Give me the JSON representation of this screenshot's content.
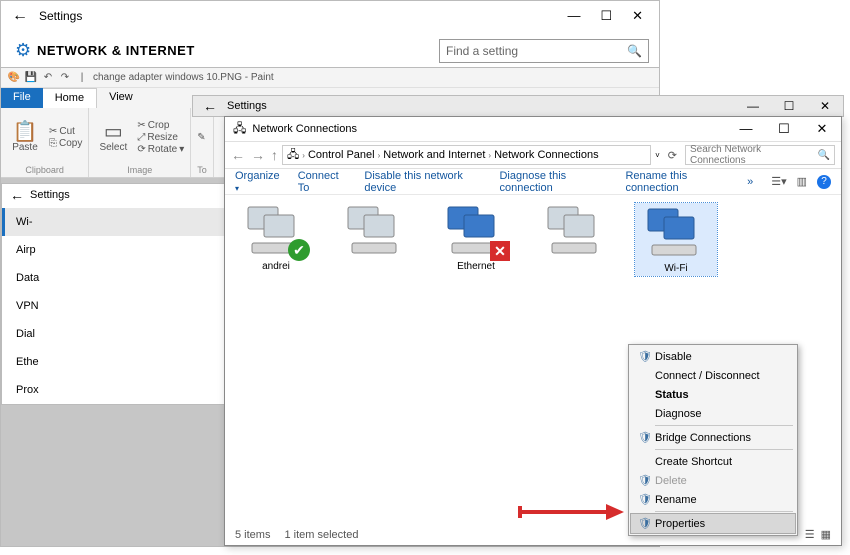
{
  "settings": {
    "title": "Settings",
    "heading": "NETWORK & INTERNET",
    "search_placeholder": "Find a setting",
    "window_buttons": {
      "min": "—",
      "max": "☐",
      "close": "✕"
    },
    "sidebar": [
      {
        "label": "Wi-Fi",
        "selected": true
      },
      {
        "label": "Airplane mode"
      },
      {
        "label": "Data usage"
      },
      {
        "label": "VPN"
      },
      {
        "label": "Dial-up"
      },
      {
        "label": "Ethernet"
      },
      {
        "label": "Proxy"
      }
    ]
  },
  "paint": {
    "filename": "change adapter windows 10.PNG - Paint",
    "tabs": {
      "file": "File",
      "home": "Home",
      "view": "View"
    },
    "ribbon": {
      "clipboard": {
        "name": "Clipboard",
        "paste": "Paste",
        "cut": "Cut",
        "copy": "Copy"
      },
      "image": {
        "name": "Image",
        "select": "Select",
        "crop": "Crop",
        "resize": "Resize",
        "rotate": "Rotate"
      },
      "tools": {
        "name": "To"
      }
    },
    "inner_settings": {
      "title": "Settings",
      "items": [
        "Wi-",
        "Airp",
        "Data",
        "VPN",
        "Dial",
        "Ethe",
        "Prox"
      ],
      "selected_index": 0
    }
  },
  "settings2_top": {
    "title": "Settings",
    "window_buttons": {
      "min": "—",
      "max": "☐",
      "close": "✕"
    }
  },
  "nc": {
    "title": "Network Connections",
    "breadcrumb": [
      "Control Panel",
      "Network and Internet",
      "Network Connections"
    ],
    "search_placeholder": "Search Network Connections",
    "toolbar": {
      "organize": "Organize",
      "connect": "Connect To",
      "disable": "Disable this network device",
      "diagnose": "Diagnose this connection",
      "rename": "Rename this connection",
      "more": "»"
    },
    "items": [
      {
        "label": "andrei",
        "overlay": "ok"
      },
      {
        "label": "",
        "overlay": ""
      },
      {
        "label": "Ethernet",
        "overlay": "x"
      },
      {
        "label": "",
        "overlay": ""
      },
      {
        "label": "Wi-Fi",
        "overlay": "",
        "selected": true
      }
    ],
    "status": {
      "count": "5 items",
      "sel": "1 item selected"
    },
    "window_buttons": {
      "min": "—",
      "max": "☐",
      "close": "✕"
    }
  },
  "context_menu": {
    "disable": "Disable",
    "connect": "Connect / Disconnect",
    "status": "Status",
    "diagnose": "Diagnose",
    "bridge": "Bridge Connections",
    "shortcut": "Create Shortcut",
    "delete": "Delete",
    "rename": "Rename",
    "properties": "Properties"
  }
}
